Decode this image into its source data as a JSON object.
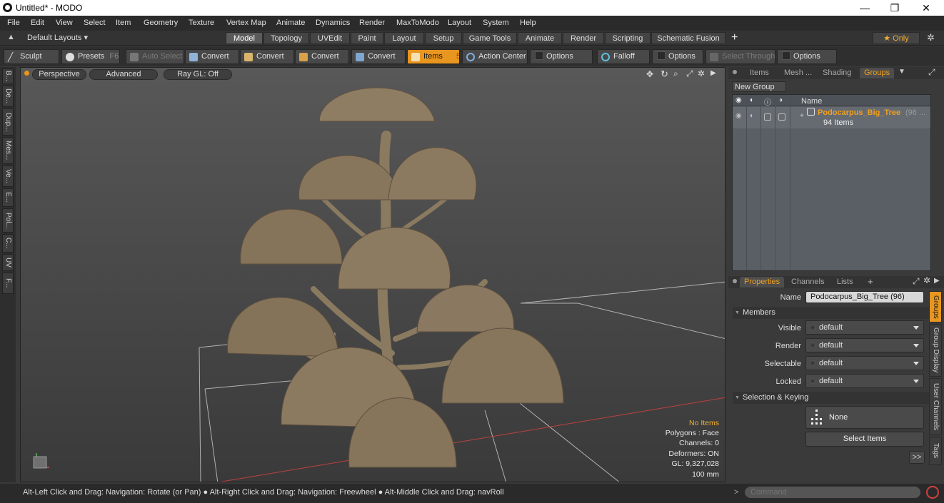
{
  "window": {
    "title": "Untitled* - MODO",
    "minimize": "—",
    "maximize": "❐",
    "close": "✕"
  },
  "menu": [
    "File",
    "Edit",
    "View",
    "Select",
    "Item",
    "Geometry",
    "Texture",
    "Vertex Map",
    "Animate",
    "Dynamics",
    "Render",
    "MaxToModo",
    "Layout",
    "System",
    "Help"
  ],
  "layoutbar": {
    "layouts_label": "Default Layouts ▾",
    "tabs": [
      "Model",
      "Topology",
      "UVEdit",
      "Paint",
      "Layout",
      "Setup",
      "Game Tools",
      "Animate",
      "Render",
      "Scripting",
      "Schematic Fusion"
    ],
    "active_tab": "Model",
    "add": "+",
    "only_label": "★  Only",
    "gear": "✲"
  },
  "toolbar": {
    "sculpt": "Sculpt",
    "presets": "Presets",
    "presets_key": "F6",
    "auto_select": "Auto Select",
    "convert1": "Convert",
    "convert2": "Convert",
    "convert3": "Convert",
    "convert4": "Convert",
    "items": "Items",
    "items_key": "5",
    "action_center": "Action Center",
    "options1": "Options",
    "falloff": "Falloff",
    "options2": "Options",
    "select_through": "Select Through",
    "options3": "Options"
  },
  "left_tabs": [
    "B...",
    "De...",
    "Dup...",
    "Mes...",
    "Ve...",
    "E...",
    "Pol...",
    "C...",
    "UV",
    "F..."
  ],
  "viewport": {
    "perspective": "Perspective",
    "advanced": "Advanced",
    "raygl": "Ray GL: Off",
    "hud": {
      "items": "No Items",
      "polygons": "Polygons : Face",
      "channels": "Channels: 0",
      "deformers": "Deformers: ON",
      "gl": "GL: 9,327,028",
      "scale": "100 mm"
    }
  },
  "groups_panel": {
    "tabs": [
      "Items",
      "Mesh ...",
      "Shading",
      "Groups"
    ],
    "active_tab": "Groups",
    "new_group": "New Group",
    "col_name": "Name",
    "group_name": "Podocarpus_Big_Tree",
    "group_count": "(96 ...",
    "group_items": "94 Items"
  },
  "properties_panel": {
    "tabs": [
      "Properties",
      "Channels",
      "Lists"
    ],
    "active_tab": "Properties",
    "add": "+",
    "name_label": "Name",
    "name_value": "Podocarpus_Big_Tree (96)",
    "members_section": "Members",
    "rows": [
      {
        "label": "Visible",
        "value": "default"
      },
      {
        "label": "Render",
        "value": "default"
      },
      {
        "label": "Selectable",
        "value": "default"
      },
      {
        "label": "Locked",
        "value": "default"
      }
    ],
    "selection_section": "Selection & Keying",
    "none_label": "None",
    "select_items": "Select Items",
    "more": ">>",
    "side_tabs": [
      "Groups",
      "Group Display",
      "User Channels",
      "Tags"
    ]
  },
  "statusbar": {
    "hint": "Alt-Left Click and Drag: Navigation: Rotate (or Pan) ● Alt-Right Click and Drag: Navigation: Freewheel ● Alt-Middle Click and Drag: navRoll",
    "command_placeholder": "Command",
    "prompt": ">"
  }
}
